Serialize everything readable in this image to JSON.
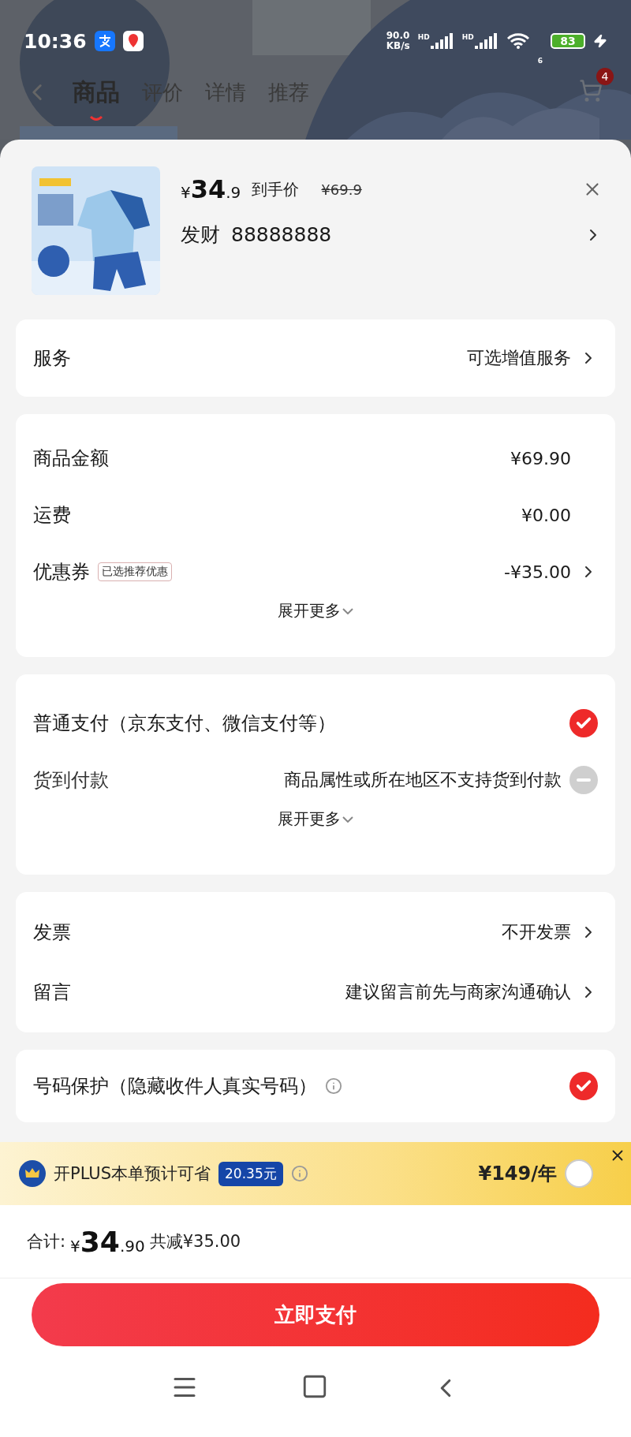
{
  "status_bar": {
    "time": "10:36",
    "speed": "90.0",
    "speed_unit": "KB/s",
    "sim_labels": [
      "HD",
      "HD"
    ],
    "wifi_label": "6",
    "battery": "83"
  },
  "header": {
    "tabs": [
      {
        "label": "商品",
        "selected": true
      },
      {
        "label": "评价",
        "selected": false
      },
      {
        "label": "详情",
        "selected": false
      },
      {
        "label": "推荐",
        "selected": false
      }
    ],
    "badge": "4"
  },
  "product": {
    "price_symbol": "¥",
    "price_int": "34",
    "price_dec": ".9",
    "price_label": "到手价",
    "original_price": "¥69.9",
    "spec_name": "发财",
    "spec_value": "88888888"
  },
  "service": {
    "label": "服务",
    "value": "可选增值服务"
  },
  "amounts": {
    "rows": [
      {
        "label": "商品金额",
        "value": "¥69.90",
        "arrow": false
      },
      {
        "label": "运费",
        "value": "¥0.00",
        "arrow": false
      },
      {
        "label": "优惠券",
        "tag": "已选推荐优惠",
        "value": "-¥35.00",
        "arrow": true
      }
    ],
    "expand": "展开更多"
  },
  "payment": {
    "options": [
      {
        "label": "普通支付（京东支付、微信支付等）",
        "checked": true,
        "disabled": false
      },
      {
        "label": "货到付款",
        "note": "商品属性或所在地区不支持货到付款",
        "disabled": true
      }
    ],
    "expand": "展开更多"
  },
  "extras": [
    {
      "label": "发票",
      "value": "不开发票"
    },
    {
      "label": "留言",
      "value": "建议留言前先与商家沟通确认"
    }
  ],
  "protection": {
    "label": "号码保护（隐藏收件人真实号码）",
    "checked": true
  },
  "plus": {
    "text": "开PLUS本单预计可省",
    "saving": "20.35元",
    "price": "¥149/年",
    "checked": false
  },
  "total": {
    "label": "合计:",
    "symbol": "¥",
    "int": "34",
    "dec": ".90",
    "discount": "共减¥35.00"
  },
  "pay_button": "立即支付"
}
